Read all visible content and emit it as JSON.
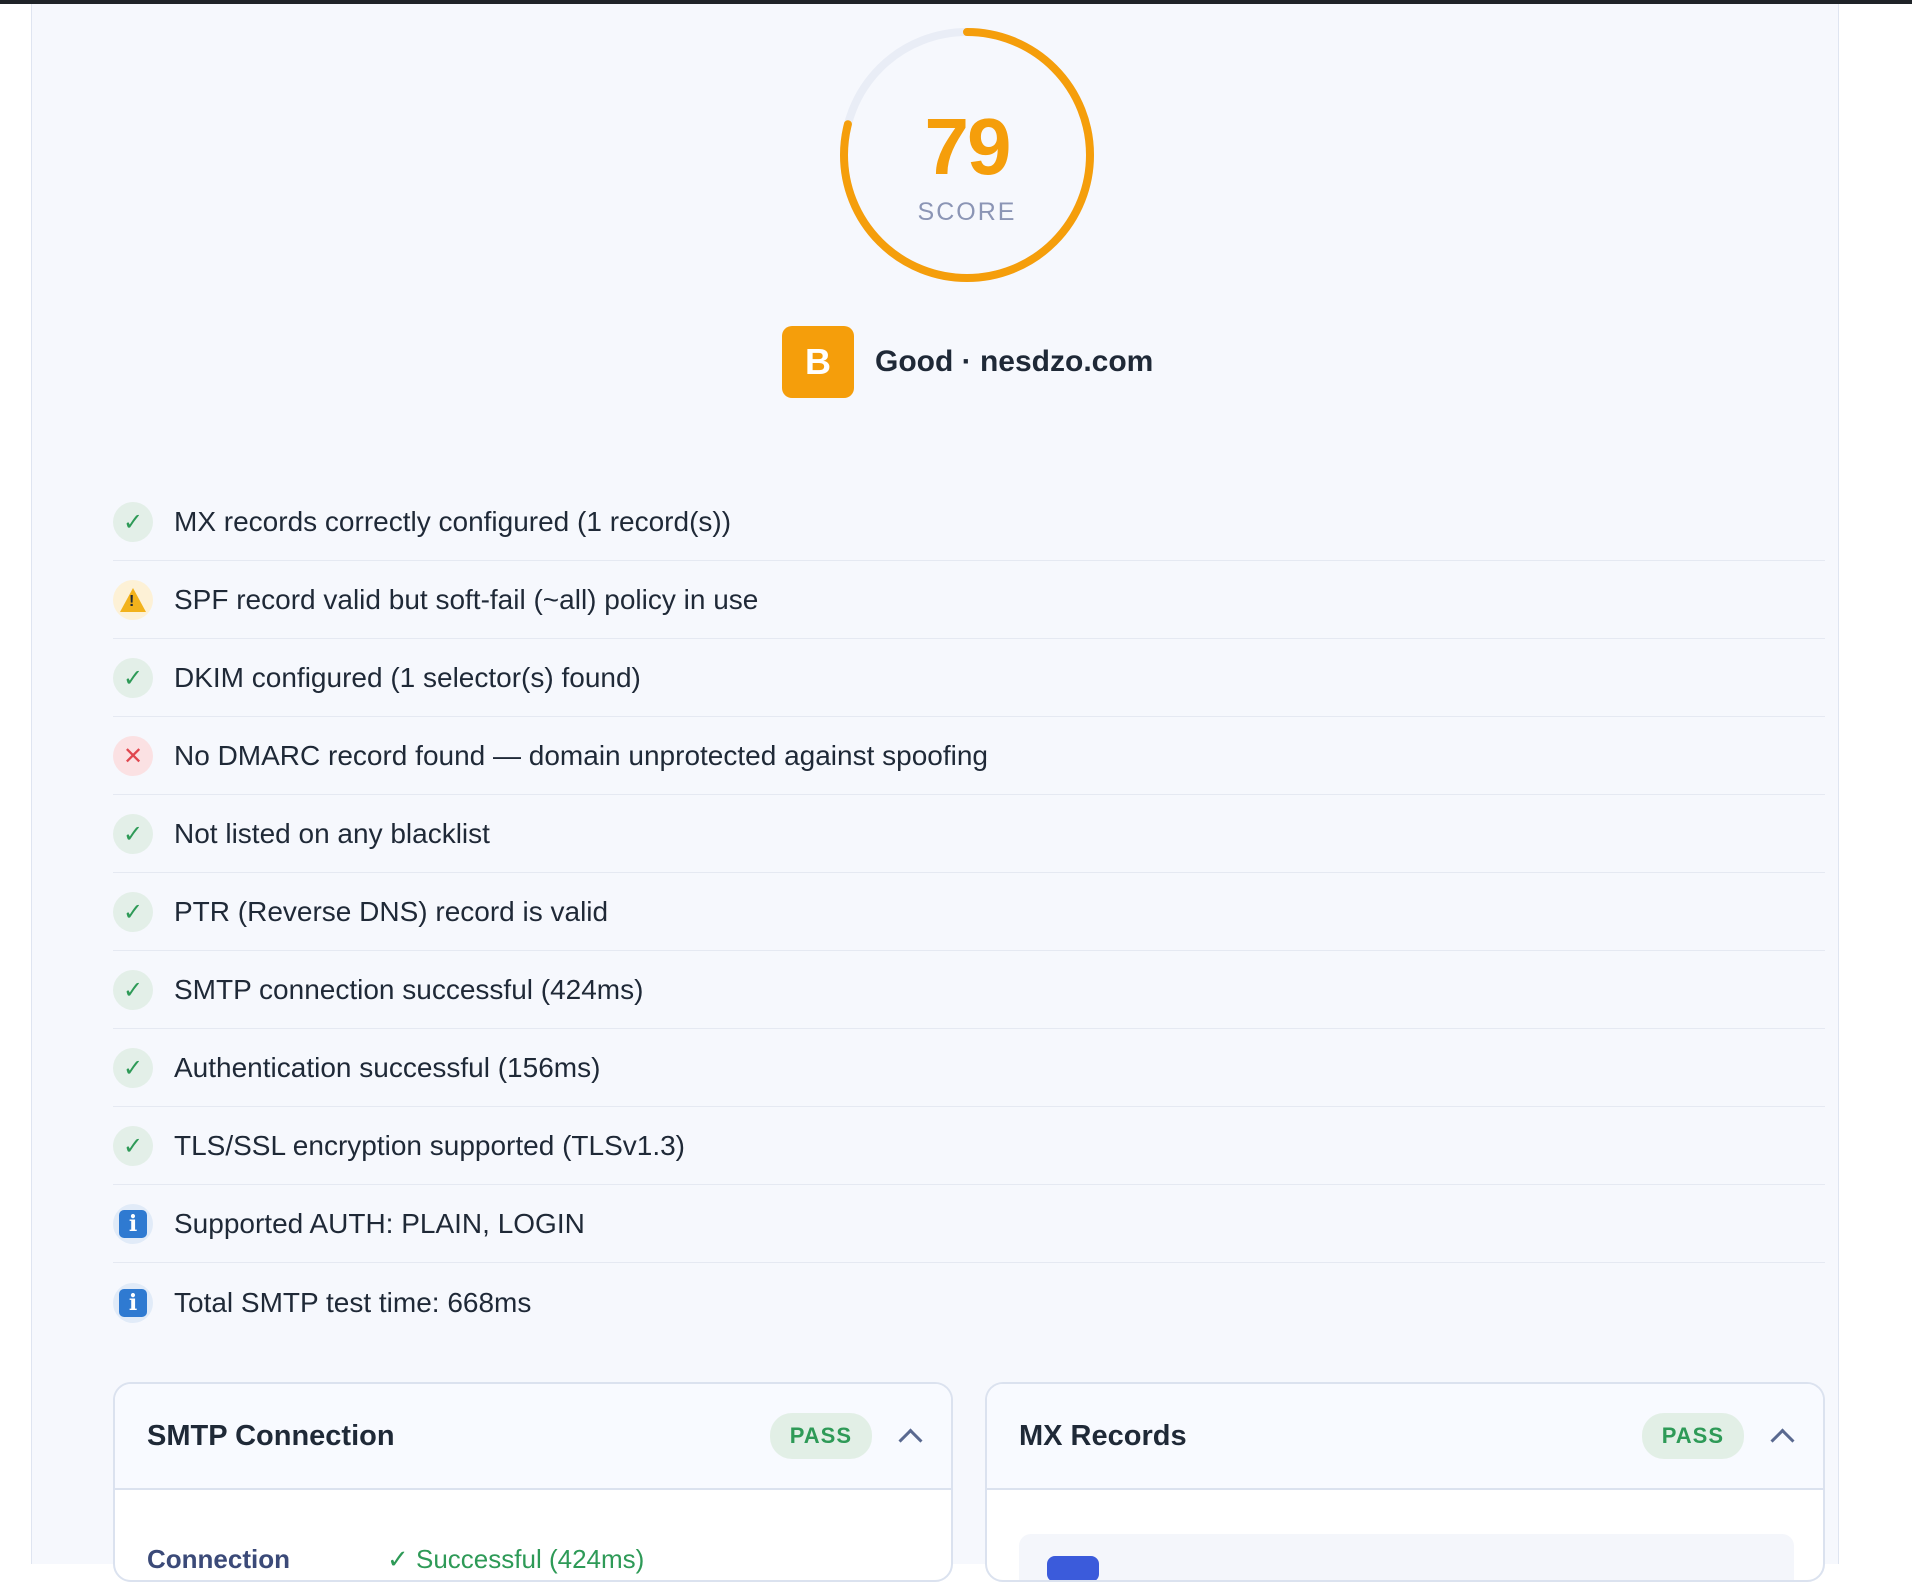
{
  "score": {
    "value": "79",
    "label": "SCORE",
    "fraction": 0.79,
    "color": "#f59e0b"
  },
  "grade": {
    "letter": "B",
    "text": "Good · nesdzo.com"
  },
  "checks": [
    {
      "status": "pass",
      "icon": "check-icon",
      "text": "MX records correctly configured (1 record(s))"
    },
    {
      "status": "warn",
      "icon": "warning-icon",
      "text": "SPF record valid but soft-fail (~all) policy in use"
    },
    {
      "status": "pass",
      "icon": "check-icon",
      "text": "DKIM configured (1 selector(s) found)"
    },
    {
      "status": "fail",
      "icon": "cross-icon",
      "text": "No DMARC record found — domain unprotected against spoofing"
    },
    {
      "status": "pass",
      "icon": "check-icon",
      "text": "Not listed on any blacklist"
    },
    {
      "status": "pass",
      "icon": "check-icon",
      "text": "PTR (Reverse DNS) record is valid"
    },
    {
      "status": "pass",
      "icon": "check-icon",
      "text": "SMTP connection successful (424ms)"
    },
    {
      "status": "pass",
      "icon": "check-icon",
      "text": "Authentication successful (156ms)"
    },
    {
      "status": "pass",
      "icon": "check-icon",
      "text": "TLS/SSL encryption supported (TLSv1.3)"
    },
    {
      "status": "info",
      "icon": "info-icon",
      "text": "Supported AUTH: PLAIN, LOGIN"
    },
    {
      "status": "info",
      "icon": "info-icon",
      "text": "Total SMTP test time: 668ms"
    }
  ],
  "cards": {
    "smtp": {
      "title": "SMTP Connection",
      "badge": "PASS",
      "row_label": "Connection",
      "row_value": "✓ Successful (424ms)"
    },
    "mx": {
      "title": "MX Records",
      "badge": "PASS"
    }
  }
}
